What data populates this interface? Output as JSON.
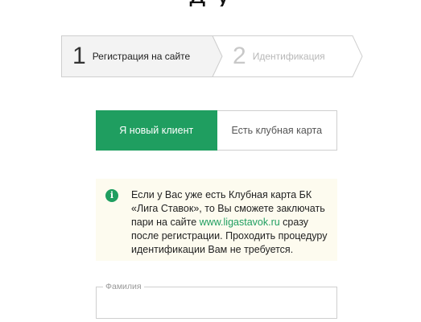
{
  "header": {
    "title_fragment": "д    у"
  },
  "steps": [
    {
      "number": "1",
      "label": "Регистрация на сайте",
      "state": "active"
    },
    {
      "number": "2",
      "label": "Идентификация",
      "state": "inactive"
    }
  ],
  "tabs": [
    {
      "label": "Я новый клиент",
      "active": true
    },
    {
      "label": "Есть клубная карта",
      "active": false
    }
  ],
  "info": {
    "icon": "info-icon",
    "text_before_link": "Если у Вас уже есть Клубная карта БК «Лига Ставок», то Вы сможете заключать пари на сайте ",
    "link_text": "www.ligastavok.ru",
    "text_after_link": " сразу после регистрации. Проходить процедуру идентификации Вам не требуется."
  },
  "form": {
    "surname": {
      "label": "Фамилия",
      "value": ""
    }
  },
  "colors": {
    "accent": "#1f9e60",
    "info_background": "#fdfbef",
    "border": "#cfcfcf"
  }
}
